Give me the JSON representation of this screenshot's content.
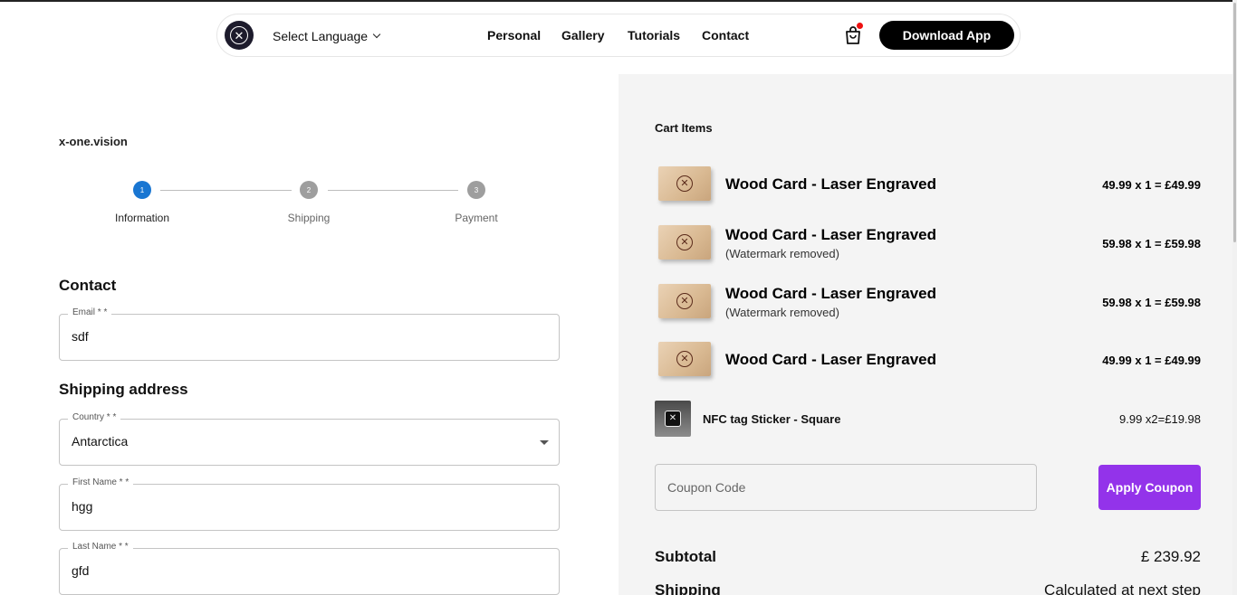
{
  "header": {
    "language_label": "Select Language",
    "nav": [
      "Personal",
      "Gallery",
      "Tutorials",
      "Contact"
    ],
    "download_label": "Download App",
    "cart_has_items": true
  },
  "checkout": {
    "brand": "x-one.vision",
    "steps": [
      {
        "number": "1",
        "label": "Information",
        "active": true
      },
      {
        "number": "2",
        "label": "Shipping",
        "active": false
      },
      {
        "number": "3",
        "label": "Payment",
        "active": false
      }
    ],
    "contact_heading": "Contact",
    "shipping_heading": "Shipping address",
    "fields": {
      "email": {
        "label": "Email * *",
        "value": "sdf"
      },
      "country": {
        "label": "Country * *",
        "value": "Antarctica"
      },
      "first_name": {
        "label": "First Name * *",
        "value": "hgg"
      },
      "last_name": {
        "label": "Last Name * *",
        "value": "gfd"
      }
    }
  },
  "cart": {
    "title": "Cart Items",
    "items": [
      {
        "name": "Wood Card - Laser Engraved",
        "note": "",
        "price": "49.99 x 1 = £49.99"
      },
      {
        "name": "Wood Card - Laser Engraved",
        "note": "(Watermark removed)",
        "price": "59.98 x 1 = £59.98"
      },
      {
        "name": "Wood Card - Laser Engraved",
        "note": "(Watermark removed)",
        "price": "59.98 x 1 = £59.98"
      },
      {
        "name": "Wood Card - Laser Engraved",
        "note": "",
        "price": "49.99 x 1 = £49.99"
      }
    ],
    "nfc": {
      "name": "NFC tag Sticker - Square",
      "price": "9.99 x2=£19.98"
    },
    "coupon_placeholder": "Coupon Code",
    "apply_label": "Apply Coupon",
    "subtotal_label": "Subtotal",
    "subtotal_value": "£ 239.92",
    "shipping_label": "Shipping",
    "shipping_value": "Calculated at next step"
  },
  "colors": {
    "accent_purple": "#9333ea",
    "step_active": "#1976d2",
    "step_inactive": "#9e9e9e",
    "panel_bg": "#f4f4f4"
  }
}
